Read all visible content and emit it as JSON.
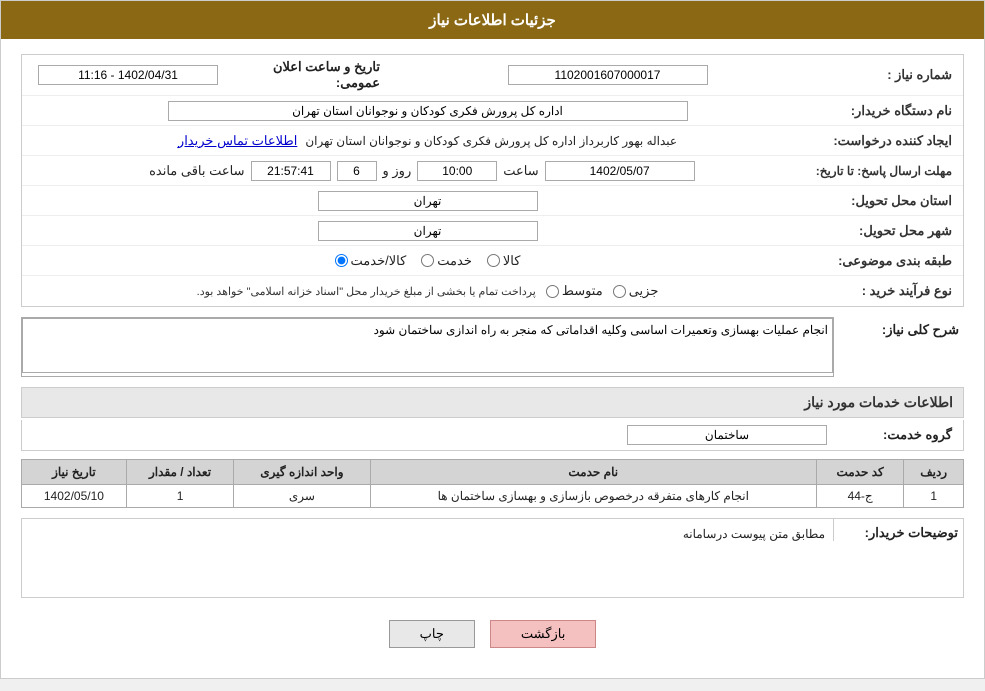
{
  "header": {
    "title": "جزئیات اطلاعات نیاز"
  },
  "fields": {
    "order_number_label": "شماره نیاز :",
    "order_number_value": "1102001607000017",
    "announce_date_label": "تاریخ و ساعت اعلان عمومی:",
    "announce_date_value": "1402/04/31 - 11:16",
    "requester_org_label": "نام دستگاه خریدار:",
    "requester_org_value": "اداره کل پرورش فکری کودکان و نوجوانان استان تهران",
    "creator_label": "ایجاد کننده درخواست:",
    "creator_value": "عبداله بهور کاربرداز اداره کل پرورش فکری کودکان و نوجوانان استان تهران",
    "contact_link": "اطلاعات تماس خریدار",
    "response_deadline_label": "مهلت ارسال پاسخ: تا تاریخ:",
    "deadline_date": "1402/05/07",
    "deadline_time_label": "ساعت",
    "deadline_time": "10:00",
    "remaining_days_label": "روز و",
    "remaining_days": "6",
    "remaining_time": "21:57:41",
    "remaining_suffix": "ساعت باقی مانده",
    "province_label": "استان محل تحویل:",
    "province_value": "تهران",
    "city_label": "شهر محل تحویل:",
    "city_value": "تهران",
    "category_label": "طبقه بندی موضوعی:",
    "category_option1": "کالا",
    "category_option2": "خدمت",
    "category_option3": "کالا/خدمت",
    "purchase_type_label": "نوع فرآیند خرید :",
    "purchase_type_option1": "جزیی",
    "purchase_type_option2": "متوسط",
    "purchase_type_note": "پرداخت تمام یا بخشی از مبلغ خریدار محل \"اسناد خزانه اسلامی\" خواهد بود.",
    "description_label": "شرح کلی نیاز:",
    "description_value": "انجام عملیات بهسازی وتعمیرات اساسی وکلیه اقداماتی که منجر به راه اندازی ساختمان شود",
    "services_section_label": "اطلاعات خدمات مورد نیاز",
    "group_label": "گروه خدمت:",
    "group_value": "ساختمان",
    "table_headers": {
      "row_num": "ردیف",
      "service_code": "کد حدمت",
      "service_name": "نام حدمت",
      "unit": "واحد اندازه گیری",
      "count": "تعداد / مقدار",
      "date": "تاریخ نیاز"
    },
    "table_rows": [
      {
        "row_num": "1",
        "service_code": "ج-44",
        "service_name": "انجام کارهای متفرقه درخصوص بازسازی و بهسازی ساختمان ها",
        "unit": "سری",
        "count": "1",
        "date": "1402/05/10"
      }
    ],
    "buyer_notes_label": "توضیحات خریدار:",
    "buyer_notes_value": "مطابق متن پیوست درسامانه"
  },
  "buttons": {
    "print": "چاپ",
    "back": "بازگشت"
  }
}
